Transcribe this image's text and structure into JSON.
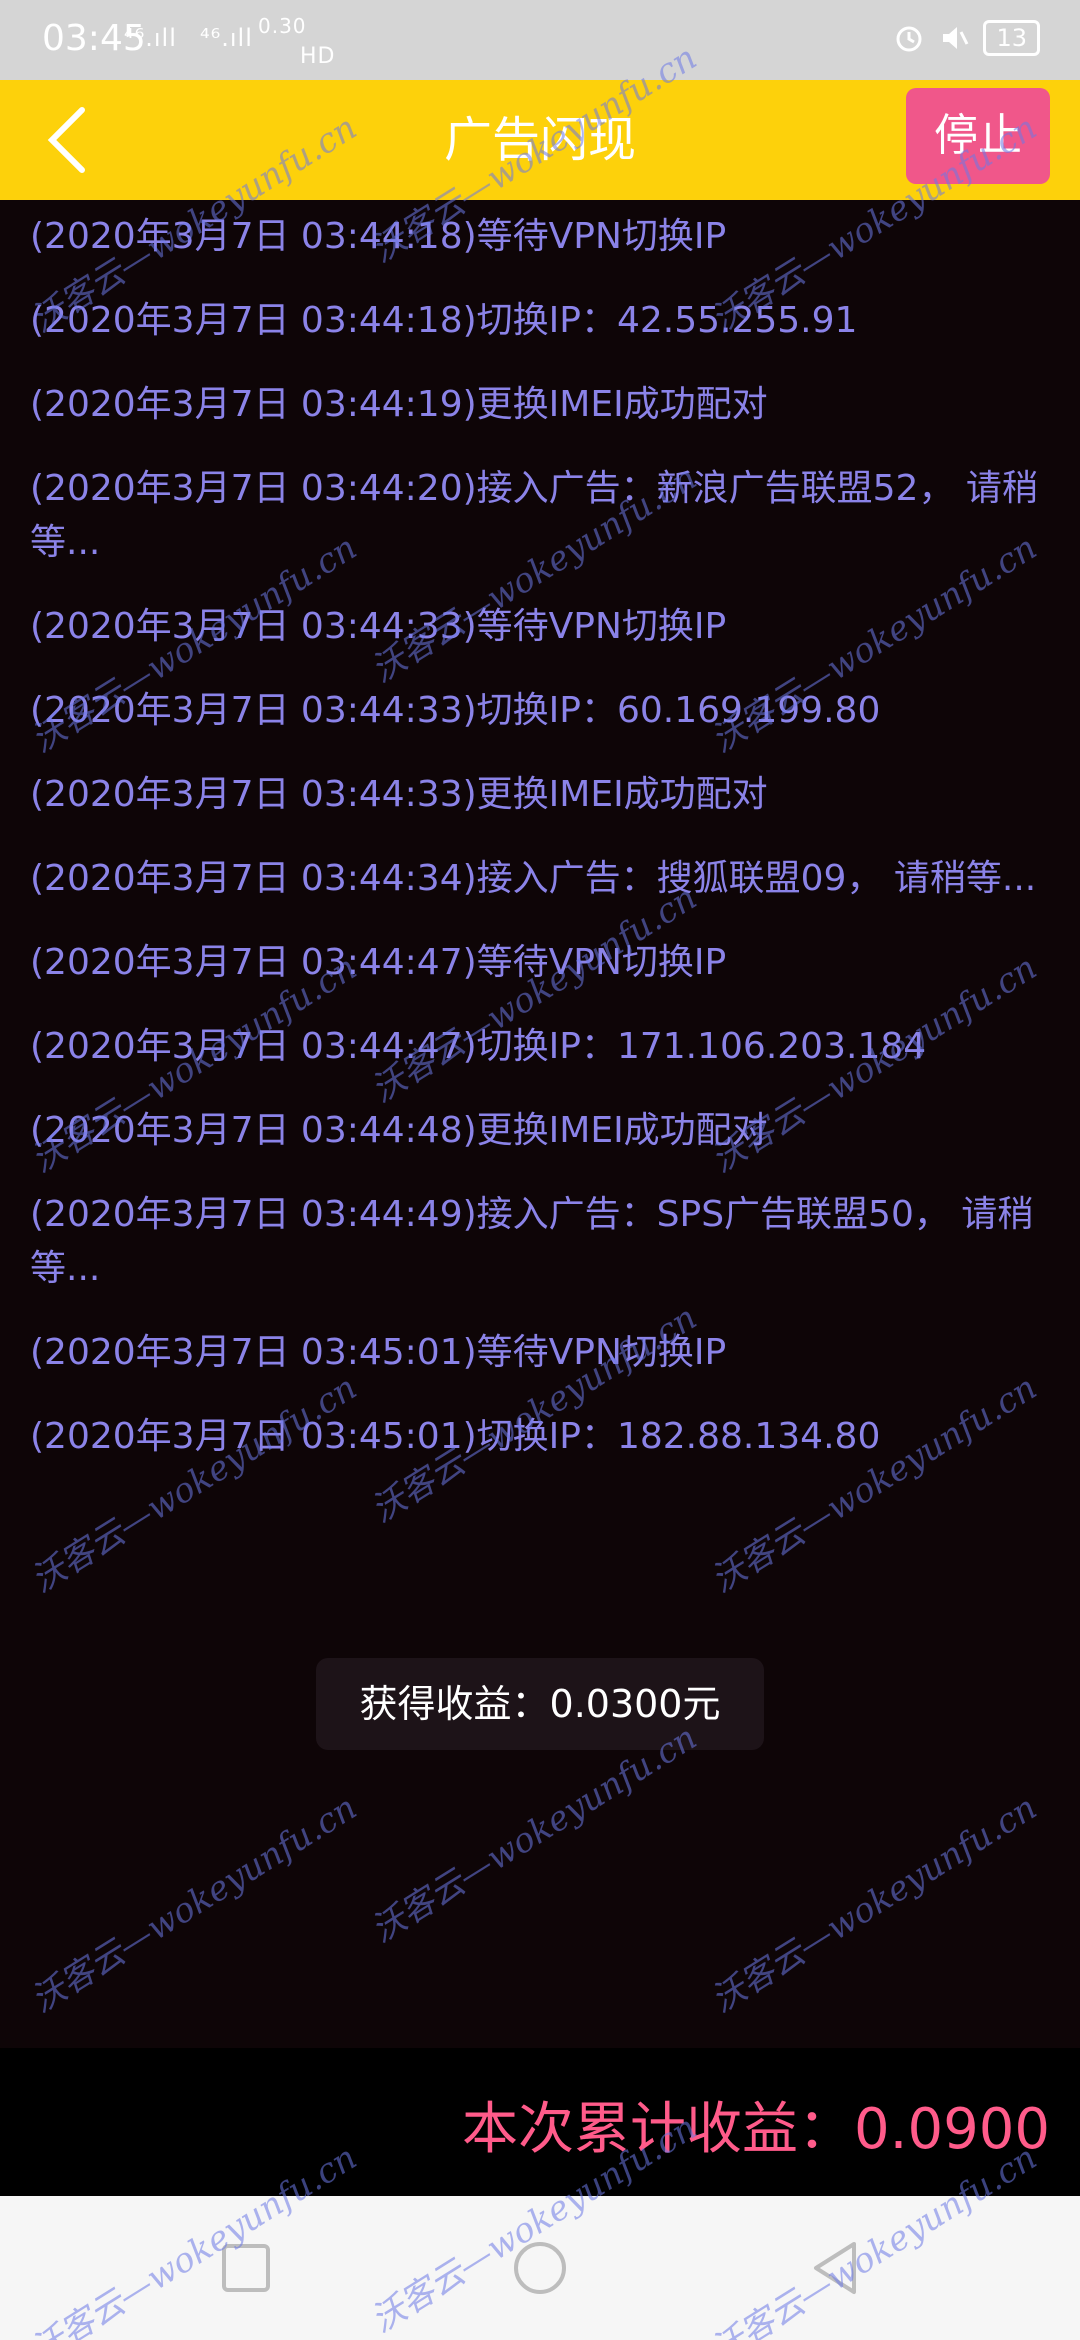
{
  "status_bar": {
    "time": "03:45",
    "signal_1": "⁴⁶.ıll",
    "signal_2": "⁴⁶.ıll",
    "speed": "0.30",
    "hd": "HD",
    "battery": "13"
  },
  "app_bar": {
    "title": "广告闪现",
    "stop_label": "停止"
  },
  "log": [
    "(2020年3月7日 03:44:18)等待VPN切换IP",
    "(2020年3月7日 03:44:18)切换IP：42.55.255.91",
    "(2020年3月7日 03:44:19)更换IMEI成功配对",
    "(2020年3月7日 03:44:20)接入广告：新浪广告联盟52， 请稍等...",
    "(2020年3月7日 03:44:33)等待VPN切换IP",
    "(2020年3月7日 03:44:33)切换IP：60.169.199.80",
    "(2020年3月7日 03:44:33)更换IMEI成功配对",
    "(2020年3月7日 03:44:34)接入广告：搜狐联盟09， 请稍等...",
    "(2020年3月7日 03:44:47)等待VPN切换IP",
    "(2020年3月7日 03:44:47)切换IP：171.106.203.184",
    "(2020年3月7日 03:44:48)更换IMEI成功配对",
    "(2020年3月7日 03:44:49)接入广告：SPS广告联盟50， 请稍等...",
    "(2020年3月7日 03:45:01)等待VPN切换IP",
    "(2020年3月7日 03:45:01)切换IP：182.88.134.80"
  ],
  "toast": "获得收益：0.0300元",
  "footer": {
    "cumulative": "本次累计收益：0.0900"
  },
  "watermark": "沃客云—wokeyunfu.cn",
  "colors": {
    "app_bar": "#fdd10b",
    "stop_button": "#f0578a",
    "log_text": "#8b83e8",
    "footer_text": "#ff5b8a",
    "background": "#0e0507"
  }
}
